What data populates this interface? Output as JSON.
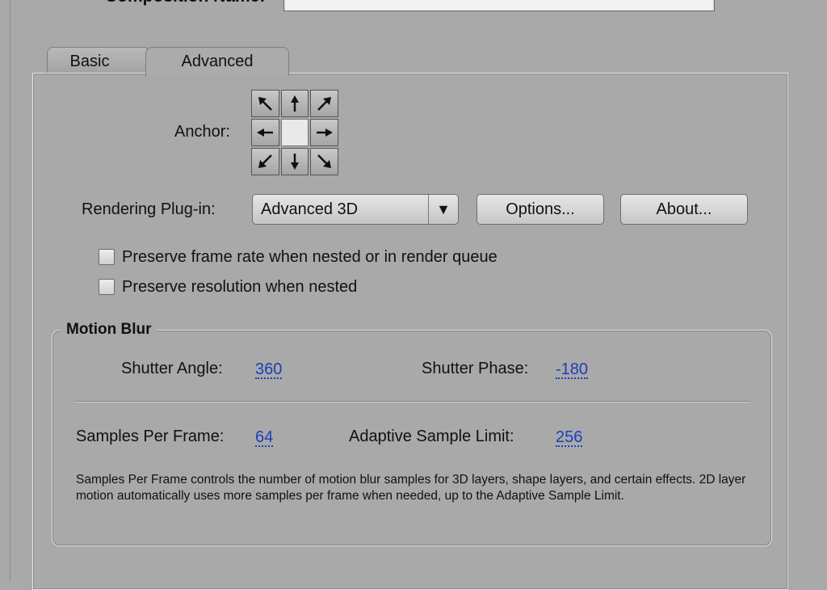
{
  "header": {
    "composition_name_label": "Composition Name:",
    "composition_name_value": ""
  },
  "tabs": [
    {
      "label": "Basic",
      "active": false
    },
    {
      "label": "Advanced",
      "active": true
    }
  ],
  "anchor": {
    "label": "Anchor:",
    "cells": [
      "arrow-nw-icon",
      "arrow-n-icon",
      "arrow-ne-icon",
      "arrow-w-icon",
      "anchor-center",
      "arrow-e-icon",
      "arrow-sw-icon",
      "arrow-s-icon",
      "arrow-se-icon"
    ]
  },
  "rendering": {
    "label": "Rendering Plug-in:",
    "selected": "Advanced 3D",
    "options_button": "Options...",
    "about_button": "About..."
  },
  "checkboxes": [
    {
      "label": "Preserve frame rate when nested or in render queue",
      "checked": false
    },
    {
      "label": "Preserve resolution when nested",
      "checked": false
    }
  ],
  "motion_blur": {
    "title": "Motion Blur",
    "shutter_angle_label": "Shutter Angle:",
    "shutter_angle_value": "360",
    "shutter_phase_label": "Shutter Phase:",
    "shutter_phase_value": "-180",
    "samples_label": "Samples Per Frame:",
    "samples_value": "64",
    "adaptive_label": "Adaptive Sample Limit:",
    "adaptive_value": "256",
    "help_text": "Samples Per Frame controls the number of motion blur samples for 3D layers, shape layers, and certain effects. 2D layer motion automatically uses more samples per frame when needed, up to the Adaptive Sample Limit."
  },
  "colors": {
    "background": "#a9a9a9",
    "value_link": "#1c3fb8"
  }
}
